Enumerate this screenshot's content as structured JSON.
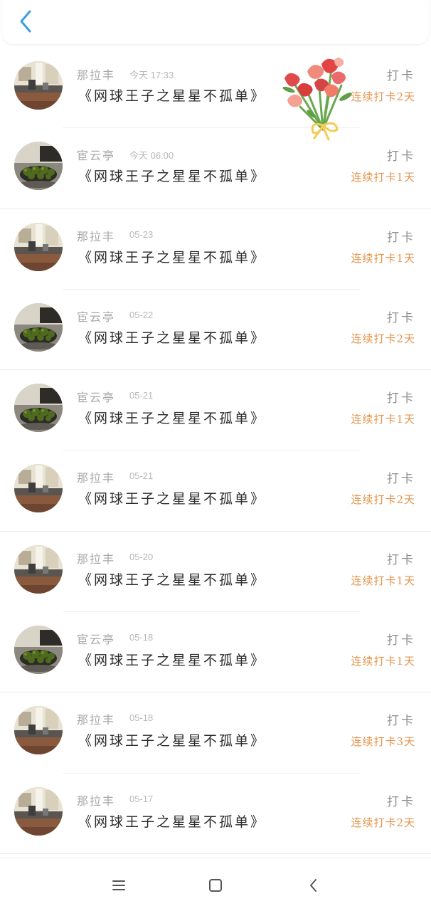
{
  "records": [
    {
      "user": "那拉丰",
      "time": "今天 17:33",
      "title": "《网球王子之星星不孤单》",
      "checkin_label": "打卡",
      "streak": "连续打卡2天",
      "avatar": "desk-photo"
    },
    {
      "user": "宦云亭",
      "time": "今天 06:00",
      "title": "《网球王子之星星不孤单》",
      "checkin_label": "打卡",
      "streak": "连续打卡1天",
      "avatar": "fruit-bowl-photo"
    },
    {
      "user": "那拉丰",
      "time": "05-23",
      "title": "《网球王子之星星不孤单》",
      "checkin_label": "打卡",
      "streak": "连续打卡1天",
      "avatar": "desk-photo"
    },
    {
      "user": "宦云亭",
      "time": "05-22",
      "title": "《网球王子之星星不孤单》",
      "checkin_label": "打卡",
      "streak": "连续打卡2天",
      "avatar": "fruit-bowl-photo"
    },
    {
      "user": "宦云亭",
      "time": "05-21",
      "title": "《网球王子之星星不孤单》",
      "checkin_label": "打卡",
      "streak": "连续打卡1天",
      "avatar": "fruit-bowl-photo"
    },
    {
      "user": "那拉丰",
      "time": "05-21",
      "title": "《网球王子之星星不孤单》",
      "checkin_label": "打卡",
      "streak": "连续打卡2天",
      "avatar": "desk-photo"
    },
    {
      "user": "那拉丰",
      "time": "05-20",
      "title": "《网球王子之星星不孤单》",
      "checkin_label": "打卡",
      "streak": "连续打卡1天",
      "avatar": "desk-photo"
    },
    {
      "user": "宦云亭",
      "time": "05-18",
      "title": "《网球王子之星星不孤单》",
      "checkin_label": "打卡",
      "streak": "连续打卡1天",
      "avatar": "fruit-bowl-photo"
    },
    {
      "user": "那拉丰",
      "time": "05-18",
      "title": "《网球王子之星星不孤单》",
      "checkin_label": "打卡",
      "streak": "连续打卡3天",
      "avatar": "desk-photo"
    },
    {
      "user": "那拉丰",
      "time": "05-17",
      "title": "《网球王子之星星不孤单》",
      "checkin_label": "打卡",
      "streak": "连续打卡2天",
      "avatar": "desk-photo"
    }
  ],
  "icons": {
    "back": "chevron-left-icon",
    "decoration": "flower-bouquet-icon",
    "nav_menu": "menu-icon",
    "nav_home": "home-square-icon",
    "nav_back": "back-triangle-icon"
  },
  "colors": {
    "accent_blue": "#3a9ee8",
    "streak_orange": "#e5944c",
    "name_gray": "#a7a7a7",
    "title_dark": "#2a2a2a"
  }
}
